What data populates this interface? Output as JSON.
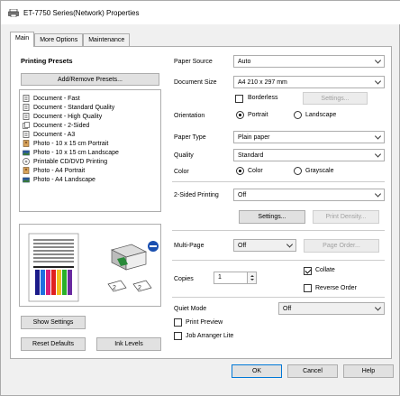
{
  "window": {
    "title": "ET-7750 Series(Network) Properties"
  },
  "tabs": [
    {
      "label": "Main",
      "active": true
    },
    {
      "label": "More Options",
      "active": false
    },
    {
      "label": "Maintenance",
      "active": false
    }
  ],
  "presets": {
    "heading": "Printing Presets",
    "add_remove_label": "Add/Remove Presets...",
    "items": [
      {
        "label": "Document - Fast",
        "icon": "document-icon"
      },
      {
        "label": "Document - Standard Quality",
        "icon": "document-icon"
      },
      {
        "label": "Document - High Quality",
        "icon": "document-icon"
      },
      {
        "label": "Document - 2-Sided",
        "icon": "document-2sided-icon"
      },
      {
        "label": "Document - A3",
        "icon": "document-icon"
      },
      {
        "label": "Photo - 10 x 15 cm Portrait",
        "icon": "photo-icon"
      },
      {
        "label": "Photo - 10 x 15 cm Landscape",
        "icon": "photo-landscape-icon"
      },
      {
        "label": "Printable CD/DVD Printing",
        "icon": "cd-icon"
      },
      {
        "label": "Photo - A4 Portrait",
        "icon": "photo-icon"
      },
      {
        "label": "Photo - A4 Landscape",
        "icon": "photo-landscape-icon"
      }
    ]
  },
  "left_buttons": {
    "show_settings": "Show Settings",
    "reset_defaults": "Reset Defaults",
    "ink_levels": "Ink Levels"
  },
  "settings": {
    "paper_source_label": "Paper Source",
    "paper_source_value": "Auto",
    "document_size_label": "Document Size",
    "document_size_value": "A4 210 x 297 mm",
    "borderless_label": "Borderless",
    "borderless_settings_label": "Settings...",
    "orientation_label": "Orientation",
    "orientation_portrait": "Portrait",
    "orientation_landscape": "Landscape",
    "paper_type_label": "Paper Type",
    "paper_type_value": "Plain paper",
    "quality_label": "Quality",
    "quality_value": "Standard",
    "color_label": "Color",
    "color_color": "Color",
    "color_grayscale": "Grayscale",
    "two_sided_label": "2-Sided Printing",
    "two_sided_value": "Off",
    "two_sided_settings_label": "Settings...",
    "print_density_label": "Print Density...",
    "multi_page_label": "Multi-Page",
    "multi_page_value": "Off",
    "page_order_label": "Page Order...",
    "copies_label": "Copies",
    "copies_value": "1",
    "collate_label": "Collate",
    "reverse_order_label": "Reverse Order",
    "quiet_mode_label": "Quiet Mode",
    "quiet_mode_value": "Off",
    "print_preview_label": "Print Preview",
    "job_arranger_label": "Job Arranger Lite"
  },
  "footer": {
    "ok": "OK",
    "cancel": "Cancel",
    "help": "Help"
  },
  "colors": {
    "accent": "#0078d7",
    "window_bg": "#f0f0f0",
    "panel_bg": "#ffffff"
  }
}
